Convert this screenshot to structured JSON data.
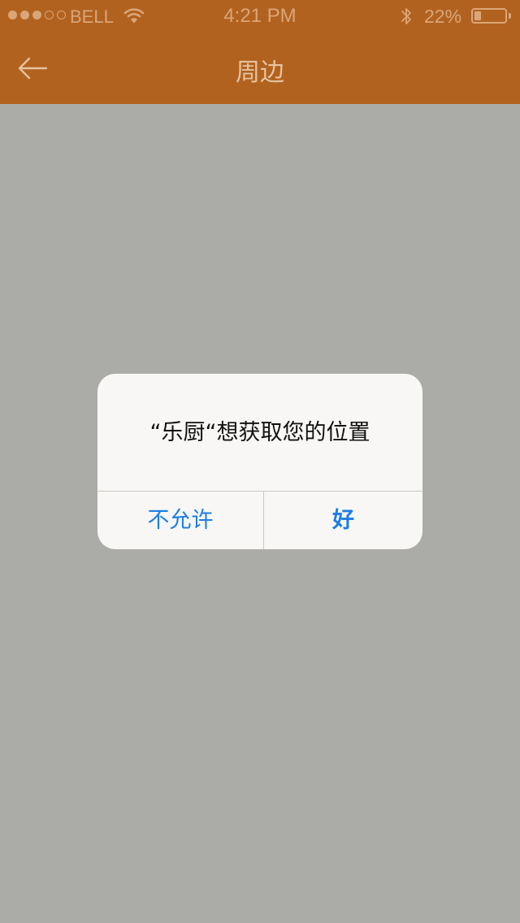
{
  "status_bar": {
    "signal_strength": 3,
    "signal_max": 5,
    "carrier": "BELL",
    "wifi_icon": "wifi-icon",
    "time": "4:21 PM",
    "bluetooth_icon": "bluetooth-icon",
    "battery_percent_text": "22%",
    "battery_level": 0.22
  },
  "nav": {
    "back_icon": "arrow-left-icon",
    "title": "周边"
  },
  "dialog": {
    "message": "“乐厨“想获取您的位置",
    "deny_label": "不允许",
    "allow_label": "好"
  },
  "colors": {
    "nav_bar": "#b2621f",
    "background": "#abaca8",
    "dialog_bg": "#f8f7f5",
    "button_text": "#1b7ee6"
  }
}
